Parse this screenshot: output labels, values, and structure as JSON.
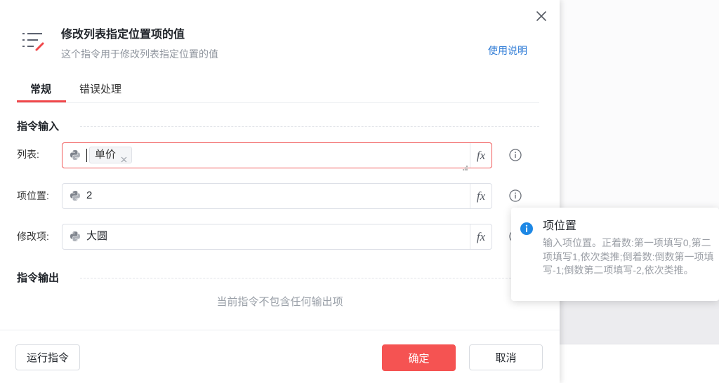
{
  "dialog": {
    "title_icon": "list-edit-icon",
    "title": "修改列表指定位置项的值",
    "subtitle": "这个指令用于修改列表指定位置的值",
    "help_link": "使用说明",
    "close_icon": "close-icon",
    "tabs": [
      {
        "label": "常规",
        "active": true
      },
      {
        "label": "错误处理",
        "active": false
      }
    ],
    "input_section": {
      "title": "指令输入",
      "fx_label": "fx",
      "fields": [
        {
          "label": "列表:",
          "value_type_icon": "python-icon",
          "tags": [
            "单价"
          ],
          "error": true,
          "info_icon": "info-icon"
        },
        {
          "label": "项位置:",
          "value_type_icon": "python-icon",
          "value": "2",
          "info_icon": "info-icon"
        },
        {
          "label": "修改项:",
          "value_type_icon": "python-icon",
          "value": "大圆",
          "info_icon": "info-icon"
        }
      ]
    },
    "output_section": {
      "title": "指令输出",
      "empty_text": "当前指令不包含任何输出项"
    },
    "footer": {
      "run_label": "运行指令",
      "confirm_label": "确定",
      "cancel_label": "取消"
    }
  },
  "tooltip": {
    "icon": "info-filled-icon",
    "title": "项位置",
    "text": "输入项位置。正着数:第一项填写0,第二项填写1,依次类推;倒着数:倒数第一项填写-1;倒数第二项填写-2,依次类推。"
  },
  "colors": {
    "accent_red": "#f55352",
    "tab_active_underline": "#f0484b",
    "link_blue": "#2c7ad6",
    "error_border": "#f05a5a",
    "info_blue": "#1e88e5"
  }
}
